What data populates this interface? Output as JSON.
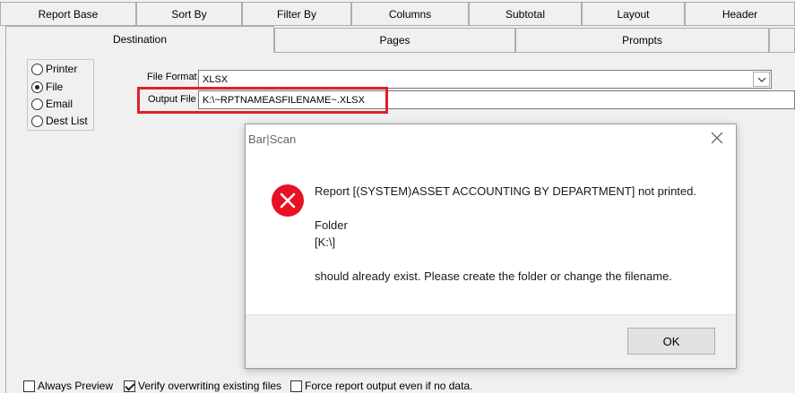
{
  "top_tabs": [
    "Report Base",
    "Sort By",
    "Filter By",
    "Columns",
    "Subtotal",
    "Layout",
    "Header"
  ],
  "sub_tabs": [
    "Destination",
    "Pages",
    "Prompts"
  ],
  "destination": {
    "options": [
      "Printer",
      "File",
      "Email",
      "Dest List"
    ],
    "selected": "File"
  },
  "file_format": {
    "label": "File Format",
    "value": "XLSX"
  },
  "output_file": {
    "label": "Output File",
    "value": "K:\\~RPTNAMEASFILENAME~.XLSX"
  },
  "options": {
    "always_preview": {
      "label": "Always Preview",
      "checked": false
    },
    "verify_overwrite": {
      "label": "Verify overwriting existing files",
      "checked": true
    },
    "force_output": {
      "label": "Force report output even if no data.",
      "checked": false
    }
  },
  "dialog": {
    "title": "Bar|Scan",
    "line1": "Report [(SYSTEM)ASSET ACCOUNTING BY DEPARTMENT] not printed.",
    "line2": "Folder",
    "line3": "[K:\\]",
    "line4": "should already exist. Please create the folder or change the filename.",
    "ok_label": "OK",
    "icon": "error-icon"
  },
  "colors": {
    "highlight": "#e0202a",
    "error": "#e81123"
  }
}
